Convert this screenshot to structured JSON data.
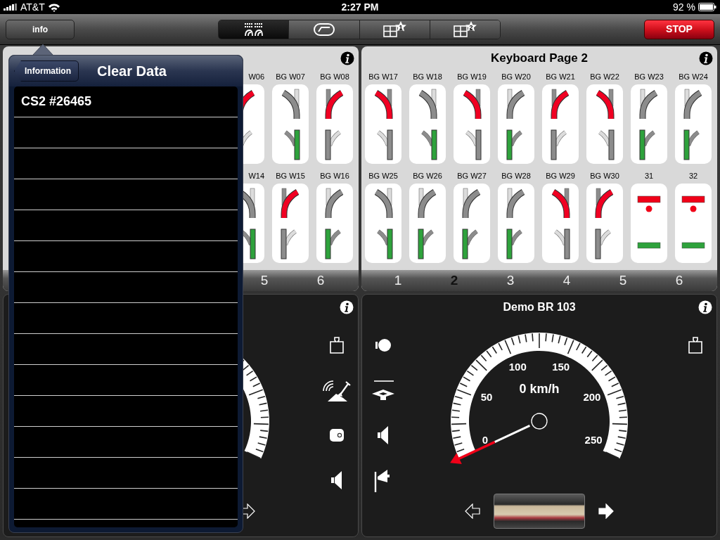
{
  "status_bar": {
    "carrier": "AT&T",
    "time": "2:27 PM",
    "battery": "92 %"
  },
  "toolbar": {
    "info_button": "info",
    "segments": [
      {
        "kind": "keyboard",
        "selected": true
      },
      {
        "kind": "controller",
        "selected": false
      },
      {
        "kind": "layout",
        "number": "1",
        "selected": false
      },
      {
        "kind": "layout",
        "number": "2",
        "selected": false
      }
    ],
    "stop_button": "STOP"
  },
  "keyboard_left": {
    "rows": [
      [
        {
          "label": "W06",
          "kind": "turnout_right",
          "thrown": true
        },
        {
          "label": "BG W07",
          "kind": "turnout_left",
          "thrown": false
        },
        {
          "label": "BG W08",
          "kind": "turnout_right",
          "thrown": true
        }
      ],
      [
        {
          "label": "W14",
          "kind": "turnout_left",
          "thrown": false
        },
        {
          "label": "BG W15",
          "kind": "turnout_right",
          "thrown": true
        },
        {
          "label": "BG W16",
          "kind": "turnout_right",
          "thrown": false
        }
      ]
    ],
    "pages": [
      {
        "label": "5",
        "selected": false
      },
      {
        "label": "6",
        "selected": false
      }
    ]
  },
  "keyboard_right": {
    "title": "Keyboard Page 2",
    "rows": [
      [
        {
          "label": "BG W17",
          "kind": "turnout_left",
          "thrown": true
        },
        {
          "label": "BG W18",
          "kind": "turnout_left",
          "thrown": false
        },
        {
          "label": "BG W19",
          "kind": "turnout_left",
          "thrown": true
        },
        {
          "label": "BG W20",
          "kind": "turnout_right",
          "thrown": false
        },
        {
          "label": "BG W21",
          "kind": "turnout_right",
          "thrown": true
        },
        {
          "label": "BG W22",
          "kind": "turnout_left",
          "thrown": true
        },
        {
          "label": "BG W23",
          "kind": "turnout_right",
          "thrown": false
        },
        {
          "label": "BG W24",
          "kind": "turnout_right",
          "thrown": false
        }
      ],
      [
        {
          "label": "BG W25",
          "kind": "turnout_left",
          "thrown": false
        },
        {
          "label": "BG W26",
          "kind": "turnout_right",
          "thrown": false
        },
        {
          "label": "BG W27",
          "kind": "turnout_right",
          "thrown": false
        },
        {
          "label": "BG W28",
          "kind": "turnout_right",
          "thrown": false
        },
        {
          "label": "BG W29",
          "kind": "turnout_left",
          "thrown": true
        },
        {
          "label": "BG W30",
          "kind": "turnout_right",
          "thrown": true
        },
        {
          "label": "31",
          "kind": "signal"
        },
        {
          "label": "32",
          "kind": "signal"
        }
      ]
    ],
    "pages": [
      {
        "label": "1",
        "selected": false
      },
      {
        "label": "2",
        "selected": true
      },
      {
        "label": "3",
        "selected": false
      },
      {
        "label": "4",
        "selected": false
      },
      {
        "label": "5",
        "selected": false
      },
      {
        "label": "6",
        "selected": false
      }
    ]
  },
  "loco_left": {
    "functions_right": [
      {
        "kind": "weight"
      },
      {
        "kind": "crane"
      },
      {
        "kind": "toggle"
      },
      {
        "kind": "sound"
      }
    ],
    "bottom_controls": [
      {
        "kind": "forward_arrow",
        "active": false
      }
    ]
  },
  "loco_right": {
    "title": "Demo BR 103",
    "functions_left": [
      {
        "kind": "headlight"
      },
      {
        "kind": "shunting"
      },
      {
        "kind": "sound"
      },
      {
        "kind": "horn"
      }
    ],
    "functions_right": [
      {
        "kind": "weight"
      }
    ],
    "gauge": {
      "labels": [
        "0",
        "50",
        "100",
        "150",
        "200",
        "250"
      ],
      "speed": "0 km/h"
    },
    "bottom_controls": [
      {
        "kind": "reverse_arrow",
        "active": false
      },
      {
        "kind": "photo"
      },
      {
        "kind": "forward_arrow",
        "active": true
      }
    ]
  },
  "popover": {
    "back_button": "Information",
    "title": "Clear Data",
    "items": [
      "CS2 #26465"
    ]
  }
}
